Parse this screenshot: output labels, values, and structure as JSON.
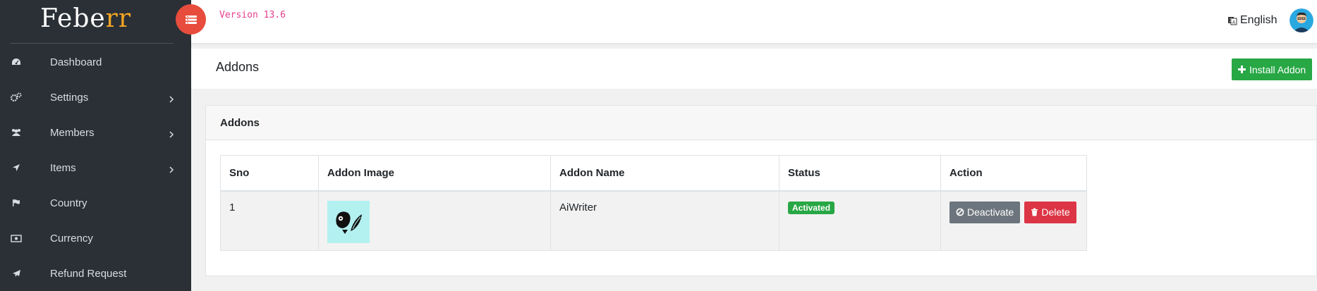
{
  "brand": {
    "logo_main": "Febe",
    "logo_accent": "rr"
  },
  "sidebar": {
    "items": [
      {
        "label": "Dashboard",
        "icon": "dashboard-icon",
        "has_submenu": false
      },
      {
        "label": "Settings",
        "icon": "cogs-icon",
        "has_submenu": true
      },
      {
        "label": "Members",
        "icon": "users-icon",
        "has_submenu": true
      },
      {
        "label": "Items",
        "icon": "location-arrow-icon",
        "has_submenu": true
      },
      {
        "label": "Country",
        "icon": "flag-icon",
        "has_submenu": false
      },
      {
        "label": "Currency",
        "icon": "money-icon",
        "has_submenu": false
      },
      {
        "label": "Refund Request",
        "icon": "send-icon",
        "has_submenu": false
      }
    ]
  },
  "topbar": {
    "version": "Version 13.6",
    "language": "English"
  },
  "page": {
    "title": "Addons",
    "install_button": "Install Addon"
  },
  "card": {
    "title": "Addons",
    "columns": [
      "Sno",
      "Addon Image",
      "Addon Name",
      "Status",
      "Action"
    ],
    "rows": [
      {
        "sno": "1",
        "name": "AiWriter",
        "status": "Activated",
        "deactivate_label": "Deactivate",
        "delete_label": "Delete"
      }
    ]
  },
  "colors": {
    "sidebar_bg": "#2b3037",
    "accent_red": "#e74c3c",
    "success": "#28a745",
    "danger": "#dc3545",
    "secondary": "#6c757d",
    "version_text": "#e83e8c"
  }
}
